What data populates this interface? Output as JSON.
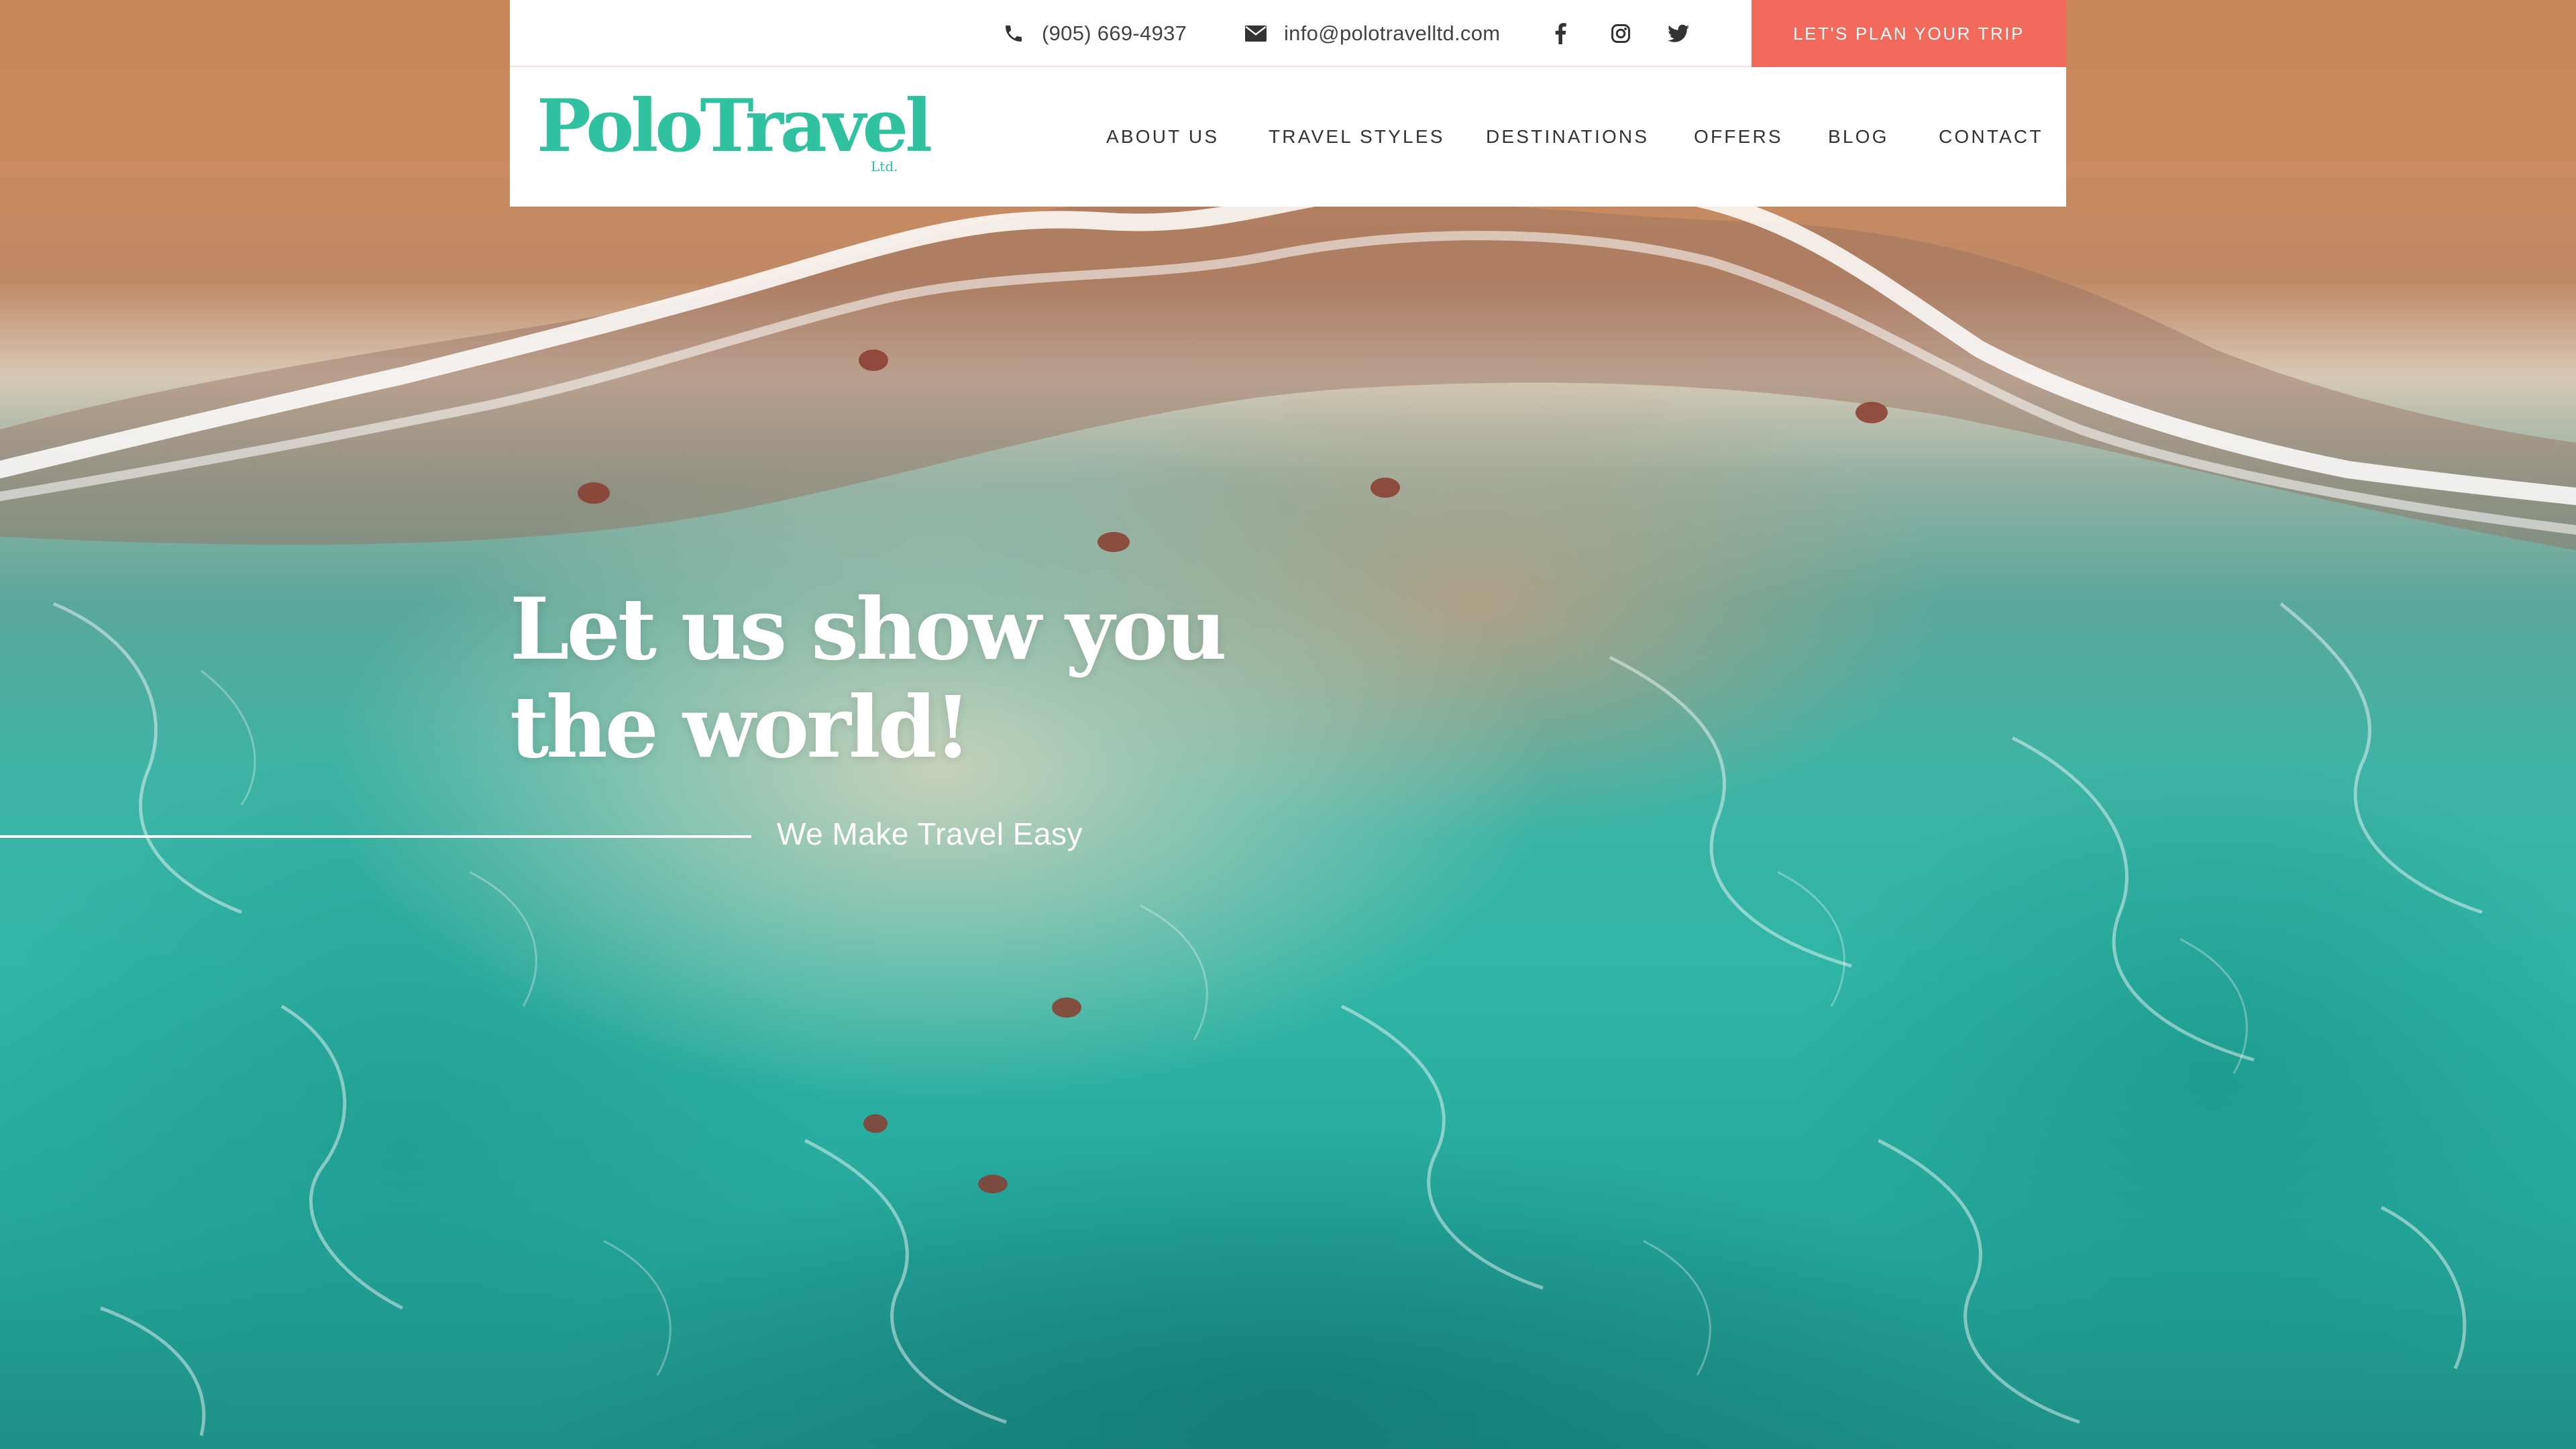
{
  "topbar": {
    "phone": "(905) 669-4937",
    "email": "info@polotravelltd.com",
    "social": [
      "facebook-icon",
      "instagram-icon",
      "twitter-icon"
    ],
    "cta_label": "LET'S PLAN YOUR TRIP"
  },
  "brand": {
    "name": "PoloTravel",
    "suffix": "Ltd.",
    "color": "#2fc1a0"
  },
  "nav": {
    "items": [
      {
        "label": "ABOUT US"
      },
      {
        "label": "TRAVEL STYLES"
      },
      {
        "label": "DESTINATIONS"
      },
      {
        "label": "OFFERS"
      },
      {
        "label": "BLOG"
      },
      {
        "label": "CONTACT"
      }
    ]
  },
  "hero": {
    "headline_line1": "Let us show you",
    "headline_line2": "the world!",
    "tagline": "We Make Travel Easy"
  },
  "colors": {
    "accent": "#f26a5b",
    "brand": "#2fc1a0",
    "text": "#333333"
  }
}
